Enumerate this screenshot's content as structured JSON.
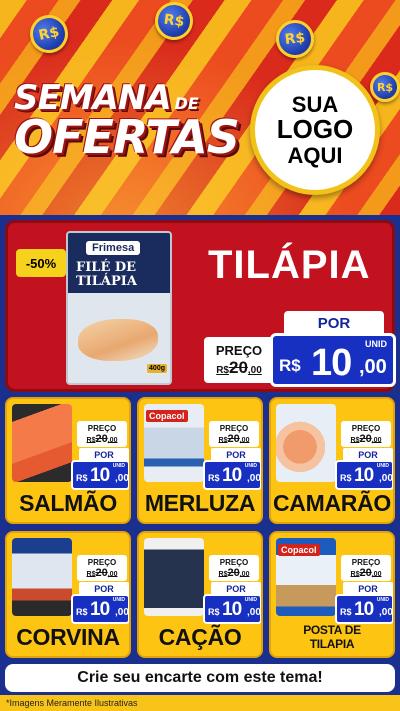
{
  "header": {
    "coin_label": "R$",
    "headline_word1": "SEMANA",
    "headline_word2": "DE",
    "headline_word3": "OFERTAS",
    "logo": {
      "line1": "SUA",
      "line2": "LOGO",
      "line3": "AQUI"
    }
  },
  "hero": {
    "discount": "-50%",
    "product_name": "TILÁPIA",
    "package": {
      "brand": "Frimesa",
      "title": "FILÉ DE TILÁPIA",
      "weight": "400g"
    },
    "old_price": {
      "label": "PREÇO",
      "currency": "R$",
      "integer": "20",
      "cents": ",00"
    },
    "new_price": {
      "label": "POR",
      "currency": "R$",
      "integer": "10",
      "cents": ",00",
      "unit": "UNID"
    }
  },
  "products": [
    {
      "name": "SALMÃO",
      "img": "salmon",
      "brand": "",
      "old_price": {
        "label": "PREÇO",
        "currency": "R$",
        "integer": "20",
        "cents": ",00"
      },
      "new_price": {
        "label": "POR",
        "currency": "R$",
        "integer": "10",
        "cents": ",00",
        "unit": "UNID"
      }
    },
    {
      "name": "MERLUZA",
      "img": "merluza",
      "brand": "Copacol",
      "old_price": {
        "label": "PREÇO",
        "currency": "R$",
        "integer": "20",
        "cents": ",00"
      },
      "new_price": {
        "label": "POR",
        "currency": "R$",
        "integer": "10",
        "cents": ",00",
        "unit": "UNID"
      }
    },
    {
      "name": "CAMARÃO",
      "img": "camarao",
      "brand": "",
      "old_price": {
        "label": "PREÇO",
        "currency": "R$",
        "integer": "20",
        "cents": ",00"
      },
      "new_price": {
        "label": "POR",
        "currency": "R$",
        "integer": "10",
        "cents": ",00",
        "unit": "UNID"
      }
    },
    {
      "name": "CORVINA",
      "img": "corvina",
      "brand": "",
      "old_price": {
        "label": "PREÇO",
        "currency": "R$",
        "integer": "20",
        "cents": ",00"
      },
      "new_price": {
        "label": "POR",
        "currency": "R$",
        "integer": "10",
        "cents": ",00",
        "unit": "UNID"
      }
    },
    {
      "name": "CAÇÃO",
      "img": "cacao",
      "brand": "",
      "old_price": {
        "label": "PREÇO",
        "currency": "R$",
        "integer": "20",
        "cents": ",00"
      },
      "new_price": {
        "label": "POR",
        "currency": "R$",
        "integer": "10",
        "cents": ",00",
        "unit": "UNID"
      }
    },
    {
      "name": "POSTA DE TILAPIA",
      "img": "posta",
      "brand": "Copacol",
      "old_price": {
        "label": "PREÇO",
        "currency": "R$",
        "integer": "20",
        "cents": ",00"
      },
      "new_price": {
        "label": "POR",
        "currency": "R$",
        "integer": "10",
        "cents": ",00",
        "unit": "UNID"
      }
    }
  ],
  "footer": {
    "cta": "Crie seu encarte com este tema!",
    "disclaimer": "*Imagens Meramente Ilustrativas"
  },
  "colors": {
    "brand_red": "#c2121f",
    "brand_blue": "#1730c2",
    "brand_yellow": "#fdc512"
  }
}
